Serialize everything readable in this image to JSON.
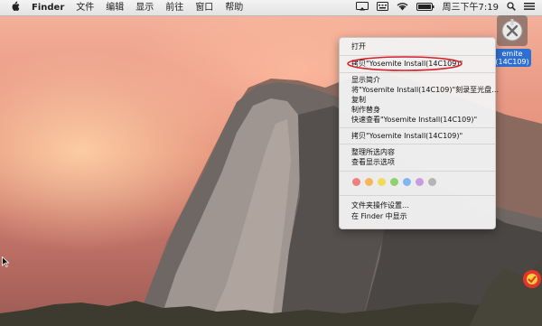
{
  "menubar": {
    "app": "Finder",
    "items": [
      "文件",
      "编辑",
      "显示",
      "前往",
      "窗口",
      "帮助"
    ],
    "clock": "周三下午7:19"
  },
  "desktop": {
    "icon_label_line1": "emite",
    "icon_label_line2": "(14C109)"
  },
  "context_menu": {
    "open": "打开",
    "highlighted": "拷贝\"Yosemite Install(14C109)\"",
    "info": "显示简介",
    "burn": "将\"Yosemite Install(14C109)\"刻录至光盘…",
    "duplicate": "复制",
    "alias": "制作替身",
    "quicklook": "快速查看\"Yosemite Install(14C109)\"",
    "copy": "拷贝\"Yosemite Install(14C109)\"",
    "clean_up": "整理所选内容",
    "view_options": "查看显示选项",
    "tag_colors": [
      "#f07f7f",
      "#f5b75e",
      "#eedc5a",
      "#8fd06f",
      "#7fb8ef",
      "#c99be0",
      "#b5b5b5"
    ],
    "folder_actions": "文件夹操作设置…",
    "show_in_finder": "在 Finder 中显示"
  },
  "accent": {
    "highlight_ellipse": "#d8202a",
    "selection_blue": "#2f6fd1"
  }
}
